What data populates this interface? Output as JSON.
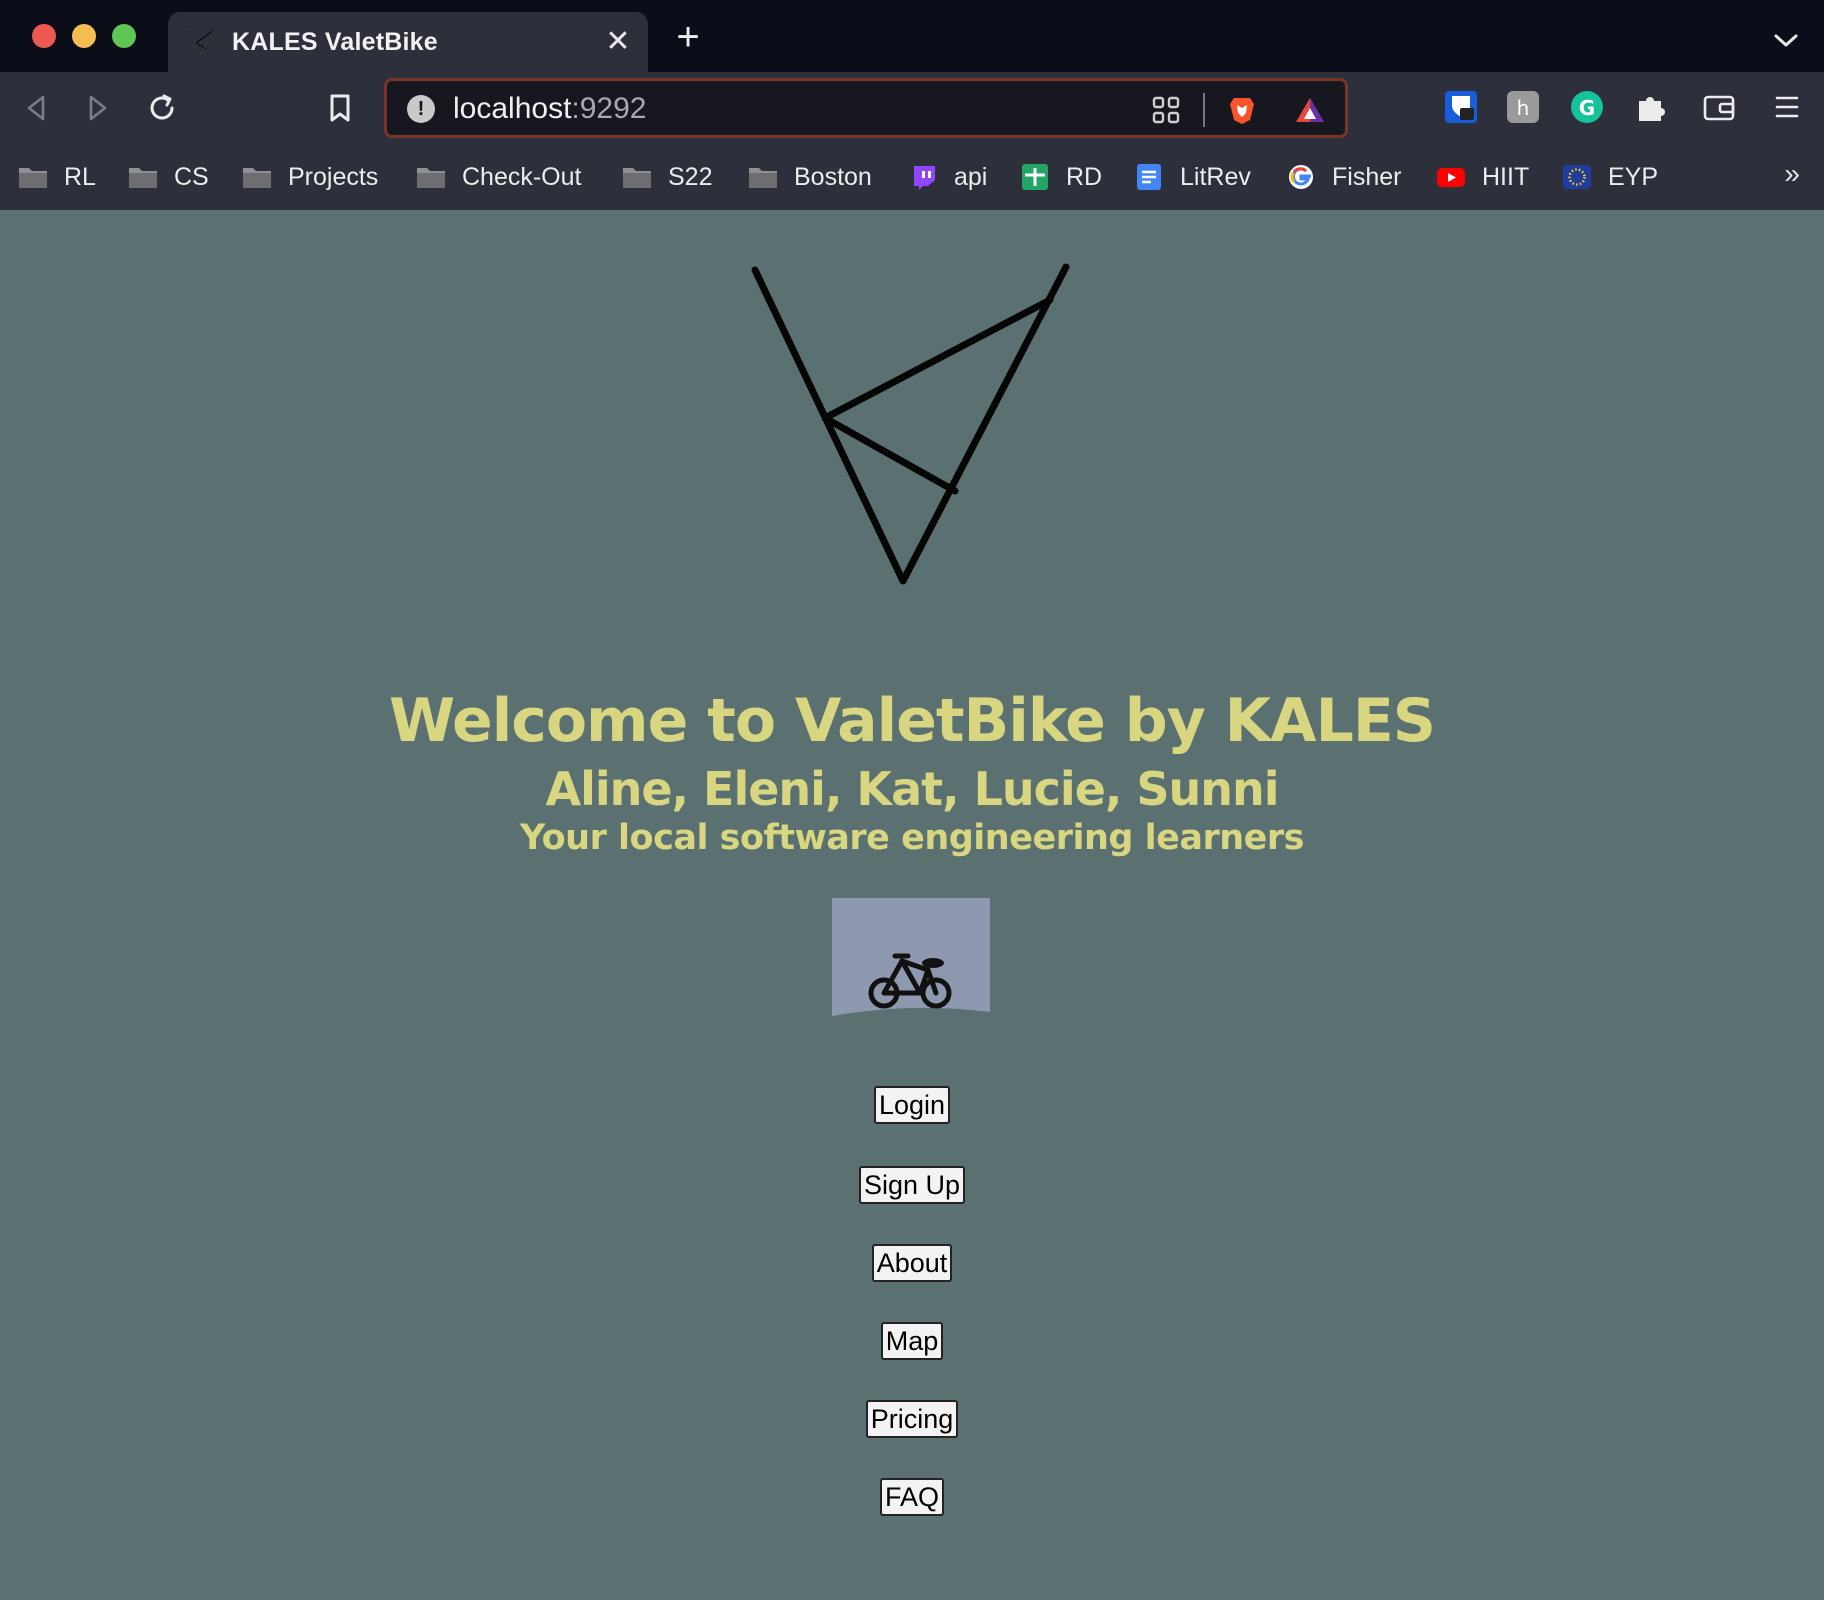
{
  "browser": {
    "tab": {
      "title": "KALES ValetBike",
      "favicon": "valetbike-logo-icon"
    },
    "url": {
      "host": "localhost",
      "port": ":9292"
    },
    "bookmarks": [
      {
        "label": "RL",
        "icon": "folder-icon"
      },
      {
        "label": "CS",
        "icon": "folder-icon"
      },
      {
        "label": "Projects",
        "icon": "folder-icon"
      },
      {
        "label": "Check-Out",
        "icon": "folder-icon"
      },
      {
        "label": "S22",
        "icon": "folder-icon"
      },
      {
        "label": "Boston",
        "icon": "folder-icon"
      },
      {
        "label": "api",
        "icon": "twitch-icon"
      },
      {
        "label": "RD",
        "icon": "sheets-icon"
      },
      {
        "label": "LitRev",
        "icon": "docs-icon"
      },
      {
        "label": "Fisher",
        "icon": "google-icon"
      },
      {
        "label": "HIIT",
        "icon": "youtube-icon"
      },
      {
        "label": "EYP",
        "icon": "eu-flag-icon"
      }
    ],
    "more_bookmarks": "»"
  },
  "page": {
    "title": "Welcome to ValetBike by KALES",
    "subtitle": "Aline, Eleni, Kat, Lucie, Sunni",
    "tagline": "Your local software engineering learners",
    "buttons": [
      {
        "label": "Login"
      },
      {
        "label": "Sign Up"
      },
      {
        "label": "About"
      },
      {
        "label": "Map"
      },
      {
        "label": "Pricing"
      },
      {
        "label": "FAQ"
      }
    ]
  },
  "colors": {
    "page_background": "#5a7071",
    "heading": "#d8d680",
    "chrome_dark": "#0b0d18",
    "chrome": "#2d2f3b",
    "url_border": "#7b3526"
  }
}
